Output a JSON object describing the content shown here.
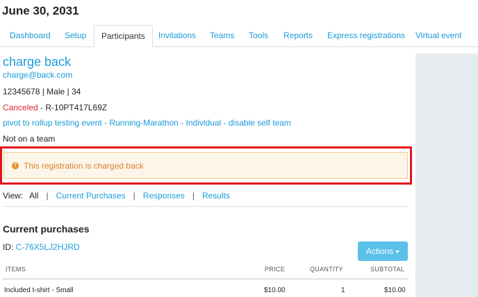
{
  "page": {
    "title": "June 30, 2031"
  },
  "tabs": [
    {
      "label": "Dashboard",
      "active": false
    },
    {
      "label": "Setup",
      "active": false
    },
    {
      "label": "Participants",
      "active": true
    },
    {
      "label": "Invitations",
      "active": false
    },
    {
      "label": "Teams",
      "active": false
    },
    {
      "label": "Tools",
      "active": false
    },
    {
      "label": "Reports",
      "active": false
    },
    {
      "label": "Express registrations",
      "active": false
    },
    {
      "label": "Virtual event",
      "active": false
    }
  ],
  "participant": {
    "name": "charge back",
    "email": "charge@back.com",
    "details": "12345678 | Male | 34",
    "status": "Canceled",
    "registration_ref": " - R-10PT417L69Z",
    "event_link": "pivot to rollup testing event",
    "event_sep1": " - ",
    "category_link": "Running-Marathon",
    "event_sep2": " - ",
    "type_link": "Individual - disable self team",
    "team": "Not on a team"
  },
  "alert": {
    "icon": "warning-icon",
    "text": "This registration is charged back",
    "color": "#d9822b"
  },
  "view_bar": {
    "label": "View:",
    "items": [
      "All",
      "Current Purchases",
      "Responses",
      "Results"
    ],
    "separator": "|"
  },
  "purchases": {
    "title": "Current purchases",
    "id_label": "ID: ",
    "id_value": "C-76X5LJ2HJRD",
    "actions_label": "Actions",
    "columns": [
      "ITEMS",
      "PRICE",
      "QUANTITY",
      "SUBTOTAL"
    ],
    "rows": [
      {
        "item": "Included t-shirt - Small",
        "price": "$10.00",
        "quantity": "1",
        "subtotal": "$10.00"
      }
    ]
  },
  "colors": {
    "link": "#1a9bd7",
    "canceled": "#e0262b",
    "highlight_border": "#e4121a",
    "actions_button": "#5bc0e8"
  }
}
